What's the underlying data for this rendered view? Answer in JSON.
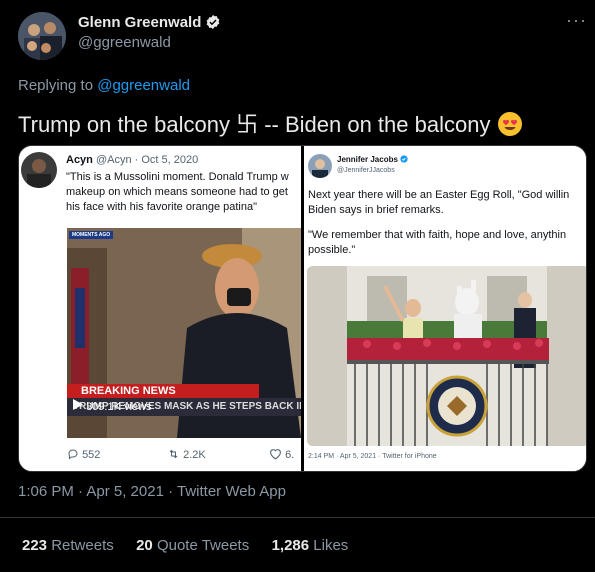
{
  "author": {
    "name": "Glenn Greenwald",
    "handle": "@ggreenwald"
  },
  "header": {
    "more_label": "···"
  },
  "reply": {
    "prefix": "Replying to ",
    "handle": "@ggreenwald"
  },
  "tweet": {
    "text_part1": "Trump on the balcony ",
    "swastika": "卐",
    "text_part2": " -- Biden on the balcony ",
    "emoji": "😍"
  },
  "embed_left": {
    "author_name": "Acyn",
    "author_handle": "@Acyn",
    "date": "· Oct 5, 2020",
    "text_line1": "\"This is a Mussolini moment. Donald Trump w",
    "text_line2": "makeup on which means someone had to get",
    "text_line3": "his face with his favorite orange patina\"",
    "video_tag": "MOMENTS AGO",
    "breaking": "BREAKING NEWS",
    "chyron": "TRUMP REMOVES MASK AS HE STEPS BACK INTO WH",
    "views": "309.1K views",
    "reply_count": "552",
    "retweet_count": "2.2K",
    "like_count": "6."
  },
  "embed_right": {
    "author_name": "Jennifer Jacobs",
    "author_handle": "@JenniferJJacobs",
    "text_line1": "Next year there will be an Easter Egg Roll, \"God willin",
    "text_line2": "Biden says in brief remarks.",
    "text_line3": "\"We remember that with faith, hope and love, anythin",
    "text_line4": "possible.\"",
    "footer": "2:14 PM · Apr 5, 2021 · Twitter for iPhone"
  },
  "meta": {
    "time": "1:06 PM · Apr 5, 2021 · Twitter Web App"
  },
  "stats": {
    "retweets_count": "223",
    "retweets_label": "Retweets",
    "quotes_count": "20",
    "quotes_label": "Quote Tweets",
    "likes_count": "1,286",
    "likes_label": "Likes"
  },
  "colors": {
    "background": "#000000",
    "link": "#1d9bf0",
    "secondary_text": "#8b98a5",
    "verified": "#e7e9ea"
  }
}
